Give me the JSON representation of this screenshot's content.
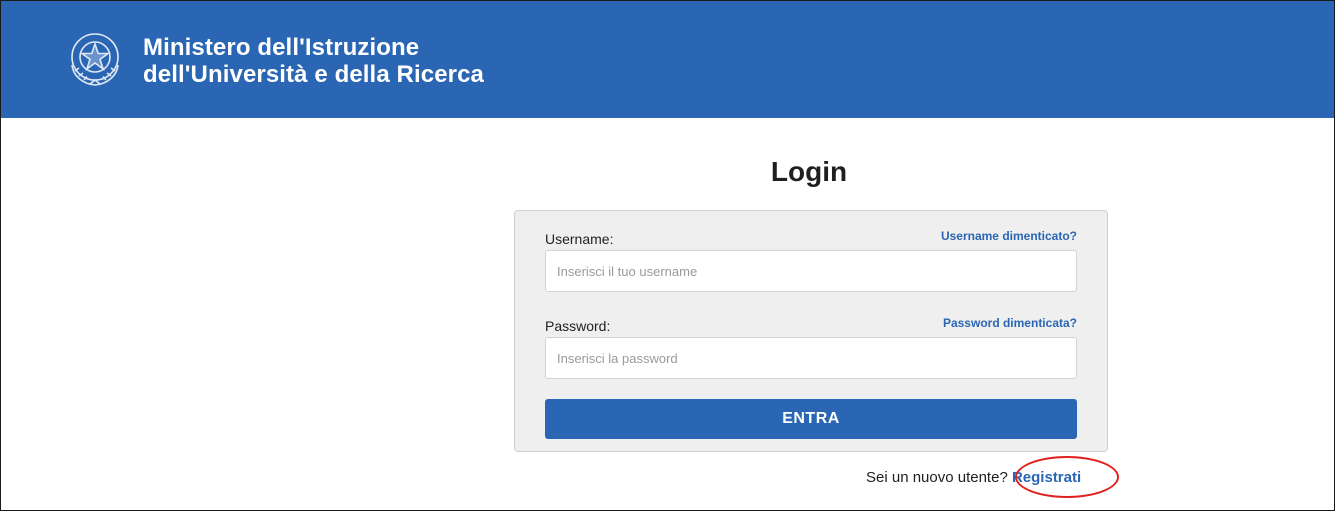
{
  "header": {
    "title_line1": "Ministero dell'Istruzione",
    "title_line2": "dell'Università e della Ricerca",
    "emblem_icon": "italian-republic-emblem-icon",
    "background_color": "#2a66b4"
  },
  "login": {
    "title": "Login",
    "username": {
      "label": "Username:",
      "forgot_link": "Username dimenticato?",
      "placeholder": "Inserisci il tuo username",
      "value": ""
    },
    "password": {
      "label": "Password:",
      "forgot_link": "Password dimenticata?",
      "placeholder": "Inserisci la password",
      "value": ""
    },
    "submit_label": "ENTRA"
  },
  "register": {
    "prompt": "Sei un nuovo utente?",
    "link_label": "Registrati",
    "highlight_color": "#e0201e"
  },
  "colors": {
    "accent": "#2a66b4",
    "panel_background": "#efefef"
  }
}
